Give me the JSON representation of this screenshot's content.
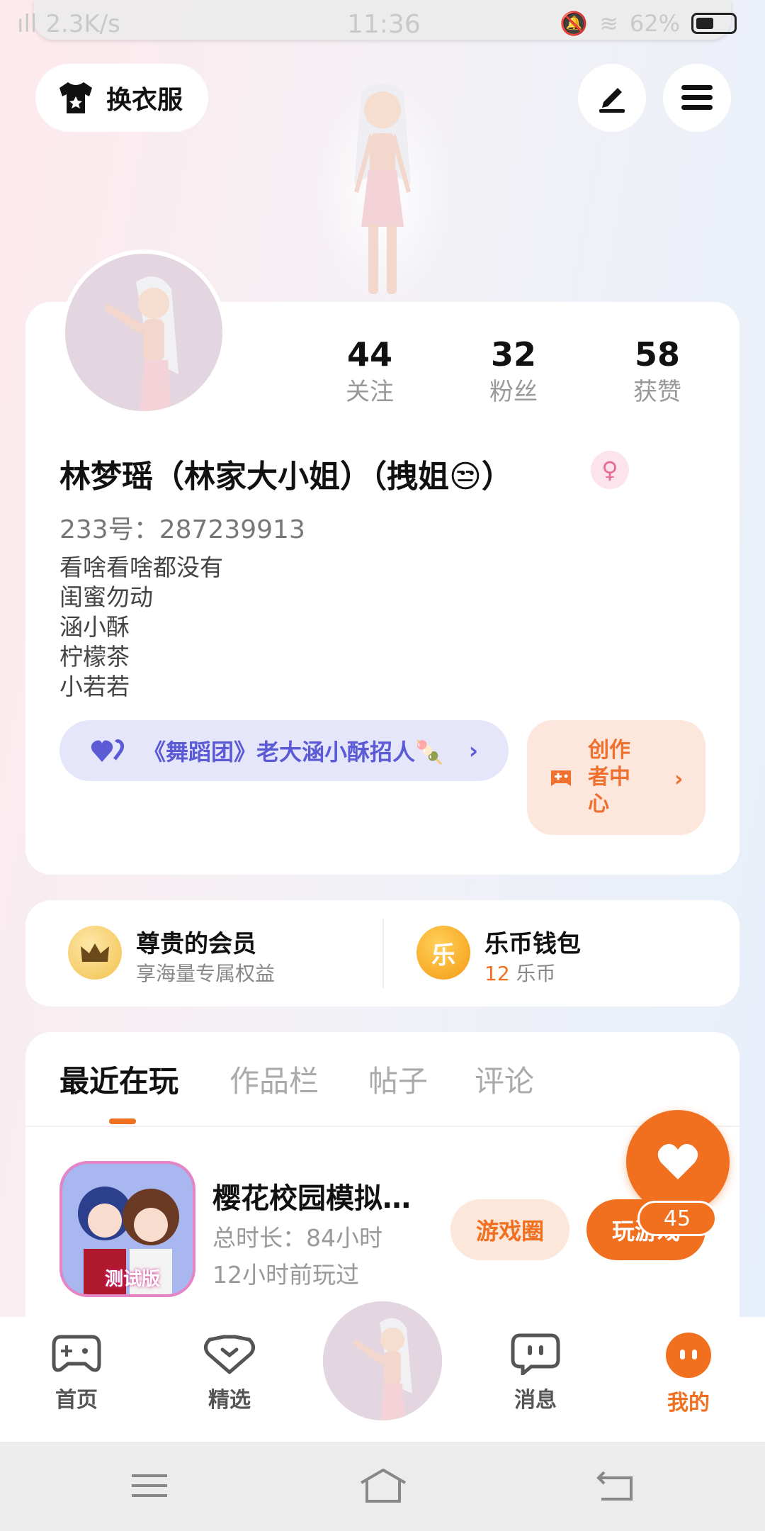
{
  "status_bar": {
    "net_speed": "2.3K/s",
    "time": "11:36",
    "battery": "62%"
  },
  "top": {
    "outfit_label": "换衣服"
  },
  "profile": {
    "stats": [
      {
        "num": "44",
        "label": "关注"
      },
      {
        "num": "32",
        "label": "粉丝"
      },
      {
        "num": "58",
        "label": "获赞"
      }
    ],
    "name": "林梦瑶（林家大小姐）（拽姐😒）",
    "uid": "233号：287239913",
    "bio": [
      "看啥看啥都没有",
      "闺蜜勿动",
      "涵小酥",
      "柠檬茶",
      "小若若"
    ],
    "announcement": "《舞蹈团》老大涵小酥招人🍡",
    "creator_label": "创作者中心"
  },
  "member": {
    "vip_title": "尊贵的会员",
    "vip_sub": "享海量专属权益",
    "wallet_title": "乐币钱包",
    "wallet_amount": "12",
    "wallet_unit": "乐币",
    "wallet_icon_char": "乐"
  },
  "tabs": [
    "最近在玩",
    "作品栏",
    "帖子",
    "评论"
  ],
  "recent_game": {
    "title": "樱花校园模拟…",
    "total_time": "总时长：84小时",
    "last_played": "12小时前玩过",
    "icon_badge": "测试版",
    "circle_button": "游戏圈",
    "play_button": "玩游戏"
  },
  "fab": {
    "count": "45"
  },
  "bottom_nav": [
    {
      "label": "首页",
      "icon": "gamepad-icon"
    },
    {
      "label": "精选",
      "icon": "heart-chat-icon"
    },
    {
      "label": "消息",
      "icon": "chat-icon"
    },
    {
      "label": "我的",
      "icon": "profile-face-icon"
    }
  ],
  "colors": {
    "accent": "#f07020",
    "announce": "#5b5bd6"
  }
}
